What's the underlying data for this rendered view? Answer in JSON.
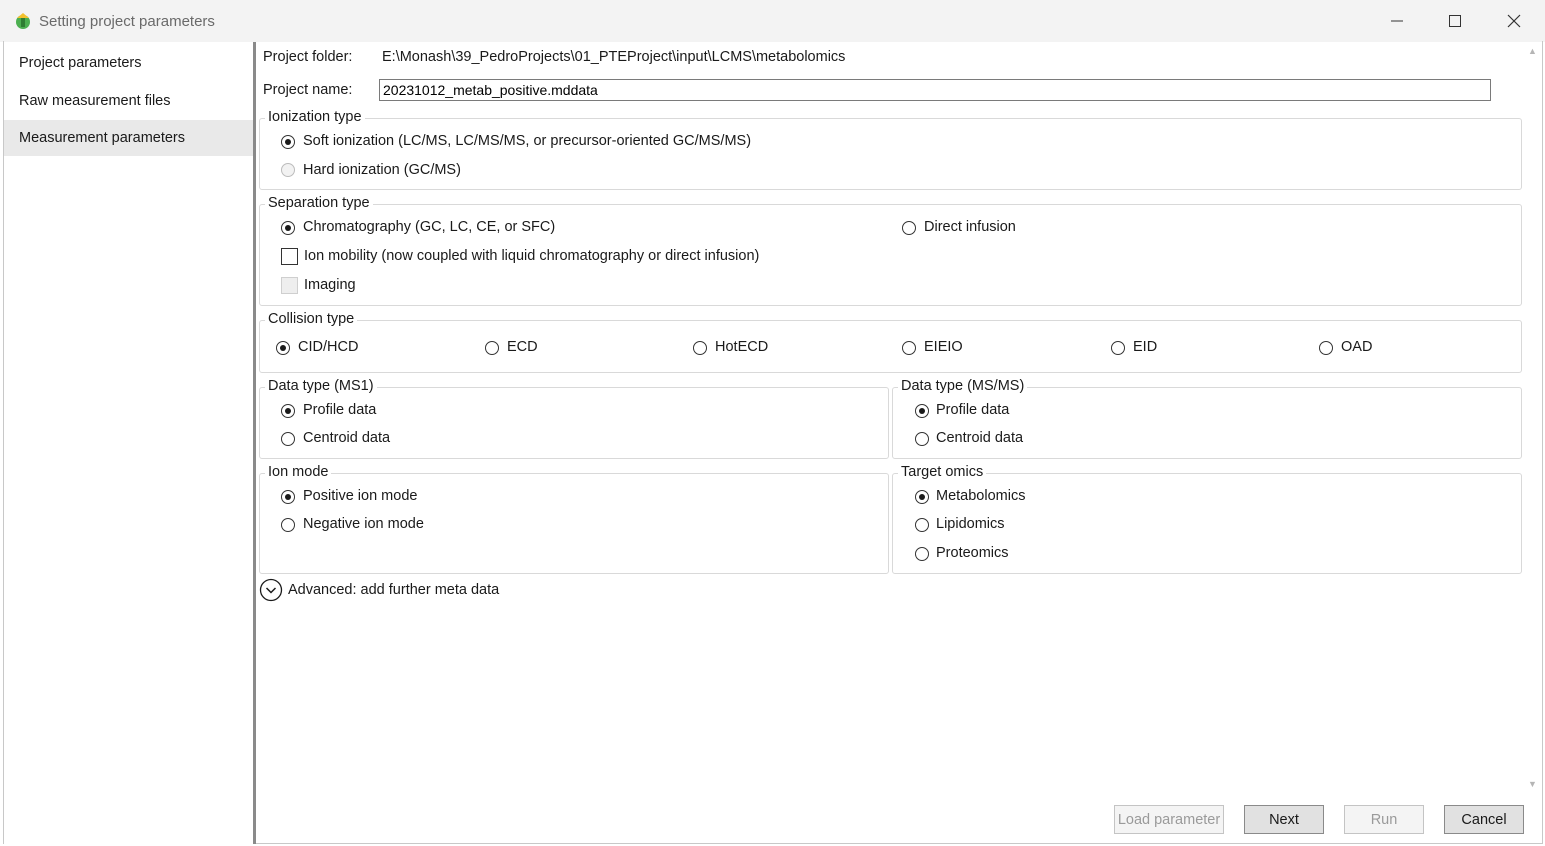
{
  "window": {
    "title": "Setting project parameters"
  },
  "sidebar": {
    "items": [
      {
        "label": "Project parameters"
      },
      {
        "label": "Raw measurement files"
      },
      {
        "label": "Measurement parameters"
      }
    ]
  },
  "project": {
    "folder_label": "Project folder:",
    "folder_value": "E:\\Monash\\39_PedroProjects\\01_PTEProject\\input\\LCMS\\metabolomics",
    "name_label": "Project name:",
    "name_value": "20231012_metab_positive.mddata"
  },
  "ionization": {
    "legend": "Ionization type",
    "options": [
      {
        "label": "Soft ionization (LC/MS, LC/MS/MS, or precursor-oriented GC/MS/MS)",
        "selected": true
      },
      {
        "label": "Hard ionization (GC/MS)",
        "selected": false,
        "disabled": true
      }
    ]
  },
  "separation": {
    "legend": "Separation type",
    "options": [
      {
        "label": "Chromatography (GC, LC, CE, or SFC)",
        "selected": true
      },
      {
        "label": "Direct infusion",
        "selected": false
      }
    ],
    "ion_mobility_label": "Ion mobility (now coupled with liquid chromatography or direct infusion)",
    "imaging_label": "Imaging"
  },
  "collision": {
    "legend": "Collision type",
    "options": [
      {
        "label": "CID/HCD",
        "selected": true
      },
      {
        "label": "ECD",
        "selected": false
      },
      {
        "label": "HotECD",
        "selected": false
      },
      {
        "label": "EIEIO",
        "selected": false
      },
      {
        "label": "EID",
        "selected": false
      },
      {
        "label": "OAD",
        "selected": false
      }
    ]
  },
  "ms1": {
    "legend": "Data type (MS1)",
    "options": [
      {
        "label": "Profile data",
        "selected": true
      },
      {
        "label": "Centroid data",
        "selected": false
      }
    ]
  },
  "msms": {
    "legend": "Data type (MS/MS)",
    "options": [
      {
        "label": "Profile data",
        "selected": true
      },
      {
        "label": "Centroid data",
        "selected": false
      }
    ]
  },
  "ion_mode": {
    "legend": "Ion mode",
    "options": [
      {
        "label": "Positive ion mode",
        "selected": true
      },
      {
        "label": "Negative ion mode",
        "selected": false
      }
    ]
  },
  "omics": {
    "legend": "Target omics",
    "options": [
      {
        "label": "Metabolomics",
        "selected": true
      },
      {
        "label": "Lipidomics",
        "selected": false
      },
      {
        "label": "Proteomics",
        "selected": false
      }
    ]
  },
  "advanced": {
    "label": "Advanced: add further meta data"
  },
  "buttons": {
    "load": "Load parameter",
    "next": "Next",
    "run": "Run",
    "cancel": "Cancel"
  },
  "colors": {
    "icon_green": "#4caf50",
    "icon_yellow": "#f2c12e",
    "sidebar_divider": "#8a8a8a"
  }
}
